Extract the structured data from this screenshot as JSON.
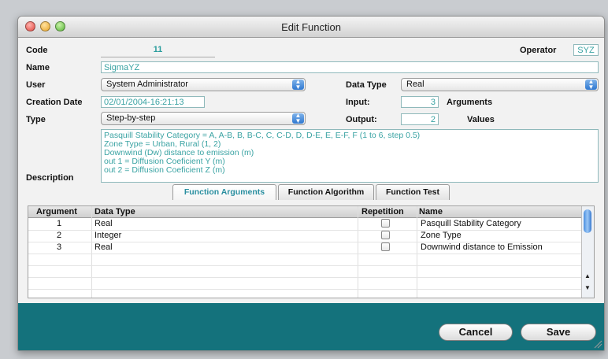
{
  "window": {
    "title": "Edit Function"
  },
  "form": {
    "code_label": "Code",
    "code_value": "11",
    "operator_label": "Operator",
    "operator_value": "SYZ",
    "name_label": "Name",
    "name_value": "SigmaYZ",
    "user_label": "User",
    "user_value": "System Administrator",
    "data_type_label": "Data Type",
    "data_type_value": "Real",
    "creation_date_label": "Creation Date",
    "creation_date_value": "02/01/2004-16:21:13",
    "input_label": "Input:",
    "input_value": "3",
    "arguments_label": "Arguments",
    "type_label": "Type",
    "type_value": "Step-by-step",
    "output_label": "Output:",
    "output_value": "2",
    "values_label": "Values",
    "description_label": "Description",
    "description_lines": [
      "Pasquill Stability Category = A, A-B, B, B-C, C, C-D, D, D-E, E, E-F, F (1 to 6, step 0.5)",
      "Zone Type = Urban, Rural (1, 2)",
      "Downwind (Dw) distance to emission (m)",
      "out 1 = Diffusion Coeficient Y (m)",
      "out 2 = Diffusion Coeficient Z (m)"
    ]
  },
  "tabs": [
    "Function Arguments",
    "Function Algorithm",
    "Function Test"
  ],
  "table": {
    "headers": [
      "Argument",
      "Data Type",
      "Repetition",
      "Name"
    ],
    "rows": [
      {
        "argument": "1",
        "data_type": "Real",
        "repetition": false,
        "name": "Pasquill Stability Category"
      },
      {
        "argument": "2",
        "data_type": "Integer",
        "repetition": false,
        "name": "Zone Type"
      },
      {
        "argument": "3",
        "data_type": "Real",
        "repetition": false,
        "name": "Downwind distance to Emission"
      }
    ]
  },
  "buttons": {
    "cancel": "Cancel",
    "save": "Save"
  },
  "colors": {
    "accent_teal": "#2a9d9d",
    "bottom_bar": "#14727c"
  }
}
